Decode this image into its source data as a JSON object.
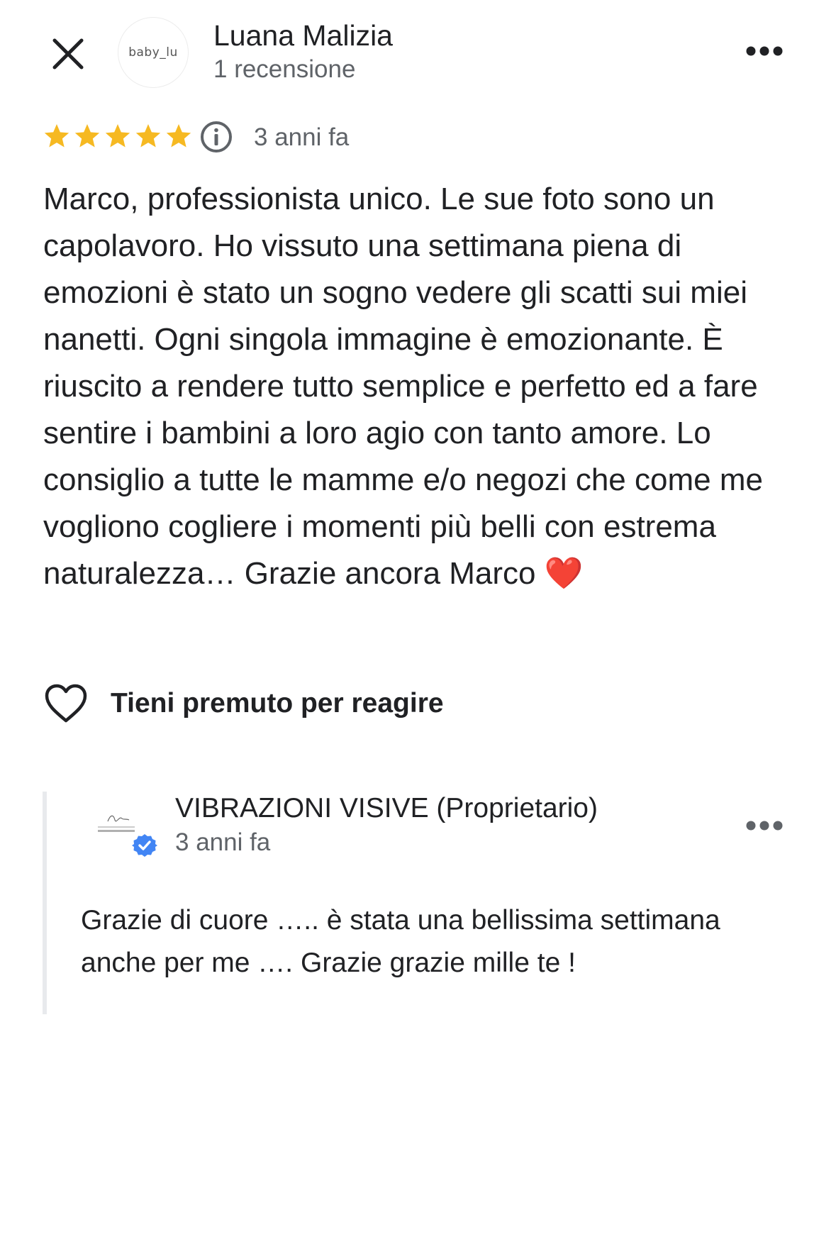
{
  "reviewer": {
    "name": "Luana Malizia",
    "meta": "1 recensione",
    "avatar_text": "baby_lu"
  },
  "rating": {
    "stars": 5,
    "max_stars": 5,
    "star_color": "#f6b922",
    "time": "3 anni fa"
  },
  "review": {
    "text": "Marco, professionista unico. Le sue foto sono un capolavoro. Ho vissuto una settimana piena di emozioni è stato un sogno vedere gli scatti sui miei nanetti. Ogni singola immagine è emozionante. È riuscito a rendere tutto semplice e perfetto ed a fare sentire i bambini a loro agio con tanto amore. Lo consiglio a tutte le mamme e/o negozi che come me vogliono cogliere i momenti più belli con estrema naturalezza… Grazie ancora Marco ❤️"
  },
  "react": {
    "label": "Tieni premuto per reagire"
  },
  "owner_reply": {
    "name": "VIBRAZIONI VISIVE (Proprietario)",
    "time": "3 anni fa",
    "avatar_text": "VIBRAZIONI VISIVE",
    "verified_color": "#4285f4",
    "text": "Grazie di cuore ….. è stata una bellissima settimana anche per me …. Grazie grazie mille te !"
  },
  "icons": {
    "close": "close-icon",
    "more": "more-horizontal-icon",
    "info": "info-icon",
    "star": "star-icon",
    "heart": "heart-outline-icon",
    "verified": "verified-badge-icon"
  }
}
